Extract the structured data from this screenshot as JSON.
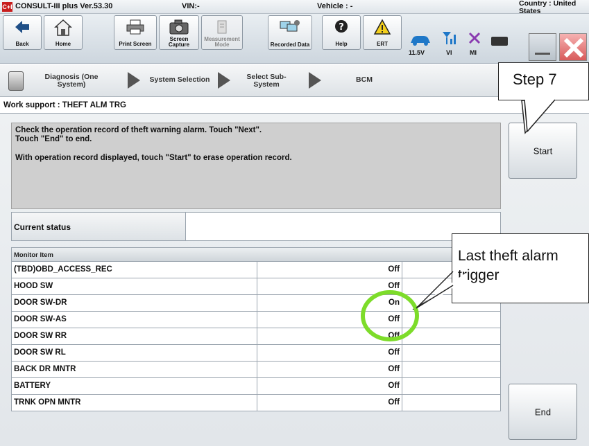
{
  "titlebar": {
    "logo": "C+I",
    "app_title": "CONSULT-III plus  Ver.53.30",
    "vin": "VIN:-",
    "vehicle": "Vehicle : -",
    "country": "Country : United States"
  },
  "toolbar": {
    "buttons": [
      {
        "label": "Back",
        "icon": "back-arrow-icon"
      },
      {
        "label": "Home",
        "icon": "home-icon"
      },
      {
        "label": "Print Screen",
        "icon": "printer-icon"
      },
      {
        "label": "Screen Capture",
        "icon": "camera-icon"
      },
      {
        "label": "Measurement Mode",
        "icon": "measurement-icon"
      },
      {
        "label": "Recorded Data",
        "icon": "recorded-data-icon"
      },
      {
        "label": "Help",
        "icon": "help-icon"
      },
      {
        "label": "ERT",
        "icon": "warning-icon"
      }
    ],
    "voltage": "11.5V",
    "vi": "VI",
    "mi": "MI"
  },
  "breadcrumb": {
    "items": [
      "Diagnosis (One System)",
      "System Selection",
      "Select Sub-System",
      "BCM"
    ]
  },
  "page_title": "Work support : THEFT ALM TRG",
  "message": {
    "line1": "Check the operation record of theft warning alarm. Touch \"Next\".",
    "line2": "Touch \"End\" to end.",
    "line3": "With operation record displayed, touch \"Start\" to erase operation record."
  },
  "buttons": {
    "start": "Start",
    "end": "End"
  },
  "status": {
    "label": "Current status",
    "value": ""
  },
  "monitor": {
    "header": "Monitor Item",
    "rows": [
      {
        "name": "(TBD)OBD_ACCESS_REC",
        "value": "Off"
      },
      {
        "name": "HOOD SW",
        "value": "Off"
      },
      {
        "name": "DOOR SW-DR",
        "value": "On"
      },
      {
        "name": "DOOR SW-AS",
        "value": "Off"
      },
      {
        "name": "DOOR SW RR",
        "value": "Off"
      },
      {
        "name": "DOOR SW RL",
        "value": "Off"
      },
      {
        "name": "BACK DR MNTR",
        "value": "Off"
      },
      {
        "name": "BATTERY",
        "value": "Off"
      },
      {
        "name": "TRNK OPN MNTR",
        "value": "Off"
      }
    ]
  },
  "callouts": {
    "step": "Step 7",
    "alarm_line1": "Last theft alarm",
    "alarm_line2": "trigger"
  },
  "colors": {
    "highlight_circle": "#7ddc2a",
    "close_button": "#d85a5a",
    "logo": "#c81e1e"
  }
}
